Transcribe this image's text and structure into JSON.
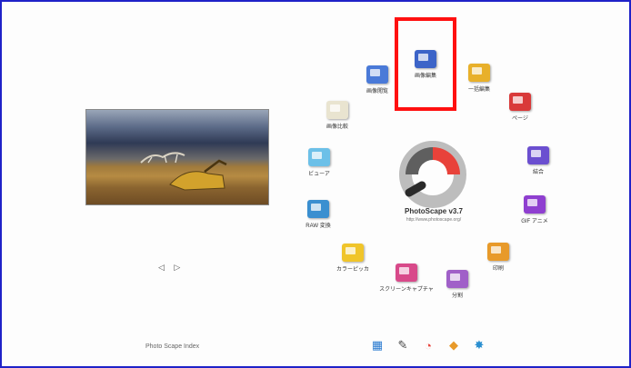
{
  "logo": {
    "name": "PhotoScape v3.7",
    "url": "http://www.photoscape.org/"
  },
  "modules": {
    "viewer_editor": "画像編集",
    "viewer": "画像閲覧",
    "page": "一括編集",
    "page2": "ページ",
    "combine": "結合",
    "gif": "GIF アニメ",
    "print": "印刷",
    "splitter": "分割",
    "screen_capture": "スクリーンキャプチャ",
    "color_picker": "カラーピッカ",
    "raw": "RAW 変換",
    "frame": "ビューア",
    "viewer2": "画像比較"
  },
  "photo_nav": "◁ ▷",
  "tip_text": "Photo Scape  Index",
  "colors": {
    "highlight": "#ff1010",
    "frame": "#1f22c8",
    "logo_red": "#e8423a",
    "logo_gray": "#8a8a8a"
  },
  "icons": [
    "photo-grid-icon",
    "pen-icon",
    "photoscape-small-icon",
    "palette-icon",
    "settings-icon"
  ]
}
